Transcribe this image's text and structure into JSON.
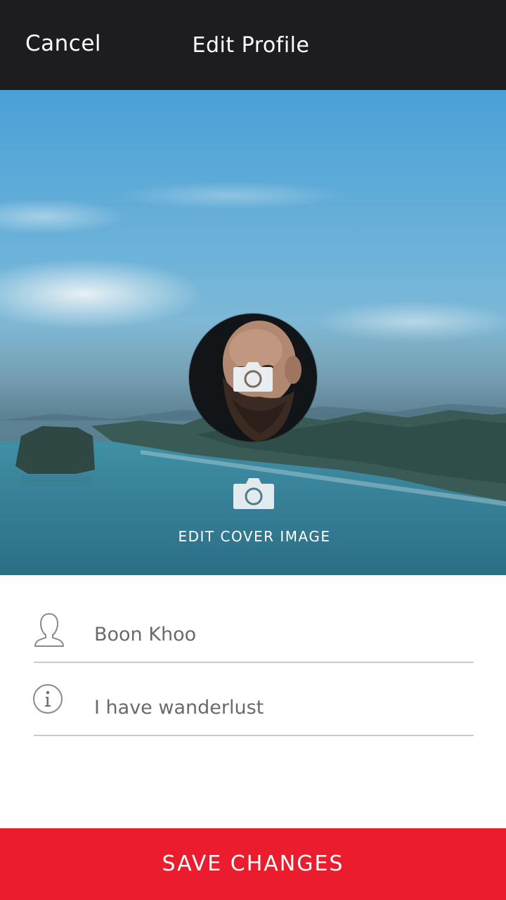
{
  "header": {
    "cancel_label": "Cancel",
    "title": "Edit Profile"
  },
  "cover": {
    "edit_label": "EDIT COVER IMAGE"
  },
  "form": {
    "name_value": "Boon Khoo",
    "bio_value": "I have wanderlust"
  },
  "footer": {
    "save_label": "SAVE CHANGES"
  },
  "icons": {
    "avatar_camera": "camera-icon",
    "cover_camera": "camera-icon",
    "name_field": "person-icon",
    "bio_field": "info-icon"
  },
  "colors": {
    "header_bg": "#1d1d1f",
    "save_button": "#ea1c2d",
    "divider": "#c9c9c9"
  }
}
